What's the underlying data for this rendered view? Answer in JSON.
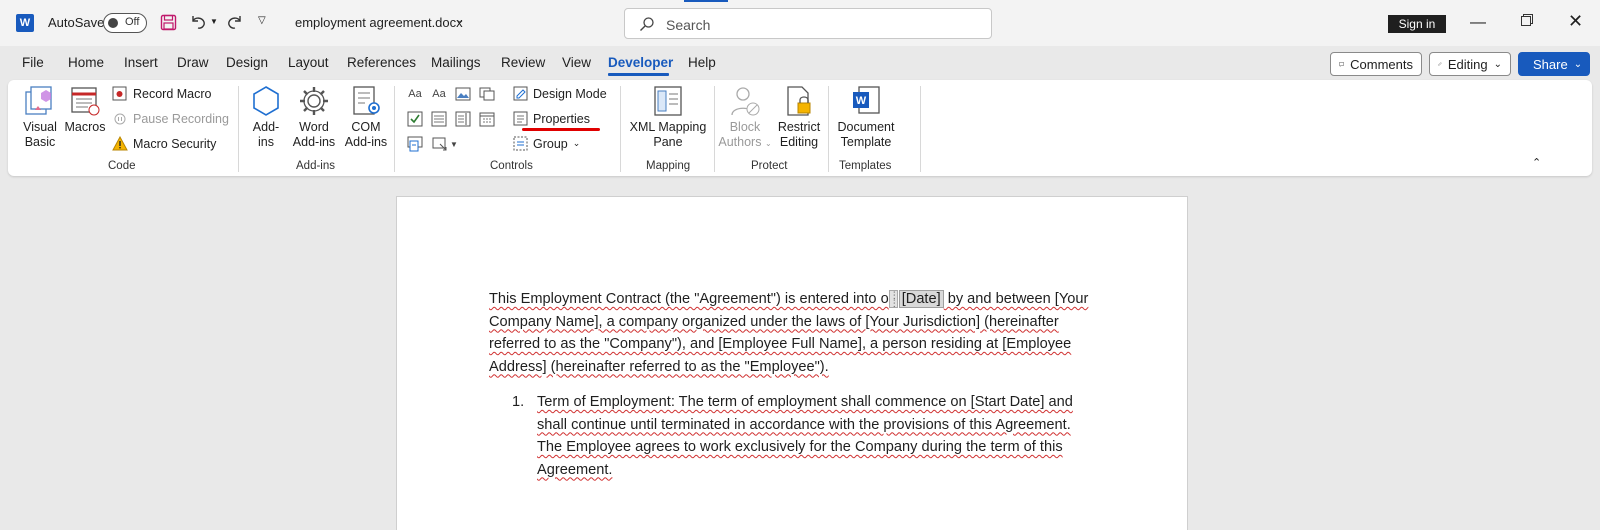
{
  "titlebar": {
    "autosave_label": "AutoSave",
    "autosave_state": "Off",
    "document_name": "employment agreement.docx",
    "search_placeholder": "Search",
    "sign_in": "Sign in",
    "icons": [
      "word-logo",
      "save-icon",
      "undo-icon",
      "redo-icon",
      "customize-qat-icon",
      "search-icon",
      "minimize-icon",
      "restore-icon",
      "close-icon"
    ]
  },
  "menu": {
    "tabs": [
      "File",
      "Home",
      "Insert",
      "Draw",
      "Design",
      "Layout",
      "References",
      "Mailings",
      "Review",
      "View",
      "Developer",
      "Help"
    ],
    "active_tab": "Developer",
    "comments": "Comments",
    "editing": "Editing",
    "share": "Share"
  },
  "ribbon": {
    "code": {
      "label": "Code",
      "visual_basic": "Visual\nBasic",
      "visual_basic_l1": "Visual",
      "visual_basic_l2": "Basic",
      "macros": "Macros",
      "record_macro": "Record Macro",
      "pause_recording": "Pause Recording",
      "macro_security": "Macro Security"
    },
    "addins": {
      "label": "Add-ins",
      "addins_l1": "Add-",
      "addins_l2": "ins",
      "word_addins_l1": "Word",
      "word_addins_l2": "Add-ins",
      "com_addins_l1": "COM",
      "com_addins_l2": "Add-ins"
    },
    "controls": {
      "label": "Controls",
      "design_mode": "Design Mode",
      "properties": "Properties",
      "group": "Group",
      "rich_text": "Aa",
      "plain_text": "Aa"
    },
    "mapping": {
      "label": "Mapping",
      "xml_l1": "XML Mapping",
      "xml_l2": "Pane"
    },
    "protect": {
      "label": "Protect",
      "block_l1": "Block",
      "block_l2": "Authors",
      "restrict_l1": "Restrict",
      "restrict_l2": "Editing"
    },
    "templates": {
      "label": "Templates",
      "doc_l1": "Document",
      "doc_l2": "Template"
    },
    "accent_underline_color": "#e00000"
  },
  "document": {
    "p1_a": "This Employment Contract (the \"Agreement\") is entered into o",
    "p1_cc": "[Date]",
    "p1_b": " by and between [Your Company Name], a company organized under the laws of [Your Jurisdiction] (hereinafter referred to as the \"Company\"), and [Employee Full Name], a person residing at [Employee Address] (hereinafter referred to as the \"Employee\").",
    "list_num": "1.",
    "list_text": "Term of Employment: The term of employment shall commence on [Start Date] and shall continue until terminated in accordance with the provisions of this Agreement. The Employee agrees to work exclusively for the Company during the term of this Agreement."
  },
  "colors": {
    "brand": "#185abd",
    "squiggle": "#d03030"
  }
}
